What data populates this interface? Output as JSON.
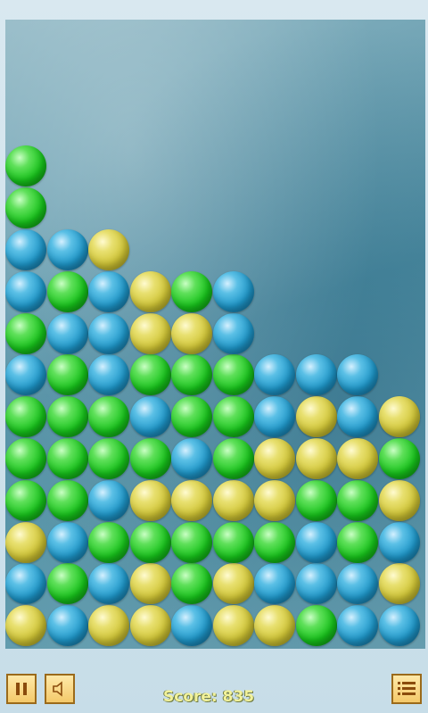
{
  "score": {
    "label": "Score:",
    "value": "835"
  },
  "colors": {
    "green": "#17c31b",
    "blue": "#1e96c8",
    "yellow": "#cfc435"
  },
  "controls": {
    "pause_icon": "pause-icon",
    "sound_icon": "speaker-icon",
    "menu_icon": "menu-list-icon"
  },
  "board": {
    "columns": 10,
    "column_stacks_bottom_to_top": [
      [
        "yellow",
        "blue",
        "yellow",
        "green",
        "green",
        "green",
        "blue",
        "green",
        "blue",
        "blue",
        "green",
        "green"
      ],
      [
        "blue",
        "green",
        "blue",
        "green",
        "green",
        "green",
        "green",
        "blue",
        "green",
        "blue"
      ],
      [
        "yellow",
        "blue",
        "green",
        "blue",
        "green",
        "green",
        "blue",
        "blue",
        "blue",
        "yellow"
      ],
      [
        "yellow",
        "yellow",
        "green",
        "yellow",
        "green",
        "blue",
        "green",
        "yellow",
        "yellow"
      ],
      [
        "blue",
        "green",
        "green",
        "yellow",
        "blue",
        "green",
        "green",
        "yellow",
        "green"
      ],
      [
        "yellow",
        "yellow",
        "green",
        "yellow",
        "green",
        "green",
        "green",
        "blue",
        "blue"
      ],
      [
        "yellow",
        "blue",
        "green",
        "yellow",
        "yellow",
        "blue",
        "blue"
      ],
      [
        "green",
        "blue",
        "blue",
        "green",
        "yellow",
        "yellow",
        "blue"
      ],
      [
        "blue",
        "blue",
        "green",
        "green",
        "yellow",
        "blue",
        "blue"
      ],
      [
        "blue",
        "yellow",
        "blue",
        "yellow",
        "green",
        "yellow"
      ]
    ]
  }
}
